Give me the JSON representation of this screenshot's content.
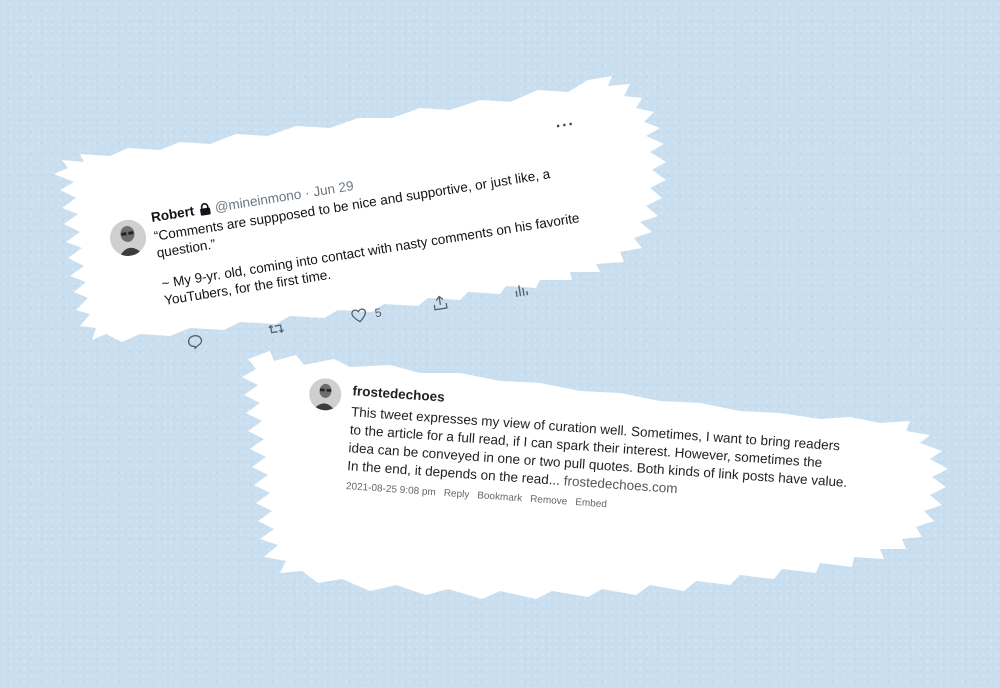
{
  "background_color": "#c9dff0",
  "tweet": {
    "name": "Robert",
    "lock_icon": "lock-icon",
    "handle": "@mineinmono",
    "separator": "·",
    "date": "Jun 29",
    "more_label": "···",
    "paragraph1": "“Comments are suppposed to be nice and supportive, or just like, a question.”",
    "paragraph2": "~ My 9-yr. old, coming into contact with nasty comments on his favorite YouTubers, for the first time.",
    "actions": {
      "reply_icon": "reply-icon",
      "retweet_icon": "retweet-icon",
      "like_icon": "heart-icon",
      "like_count": "5",
      "share_icon": "share-icon",
      "analytics_icon": "analytics-icon"
    }
  },
  "comment": {
    "author": "frostedechoes",
    "text": "This tweet expresses my view of curation well. Sometimes, I want to bring readers to the article for a full read, if I can spark their interest. However, sometimes the idea can be conveyed in one or two pull quotes. Both kinds of link posts have value. In the end, it depends on the read...",
    "link": "frostedechoes.com",
    "timestamp": "2021-08-25 9:08 pm",
    "actions": [
      "Reply",
      "Bookmark",
      "Remove",
      "Embed"
    ]
  }
}
